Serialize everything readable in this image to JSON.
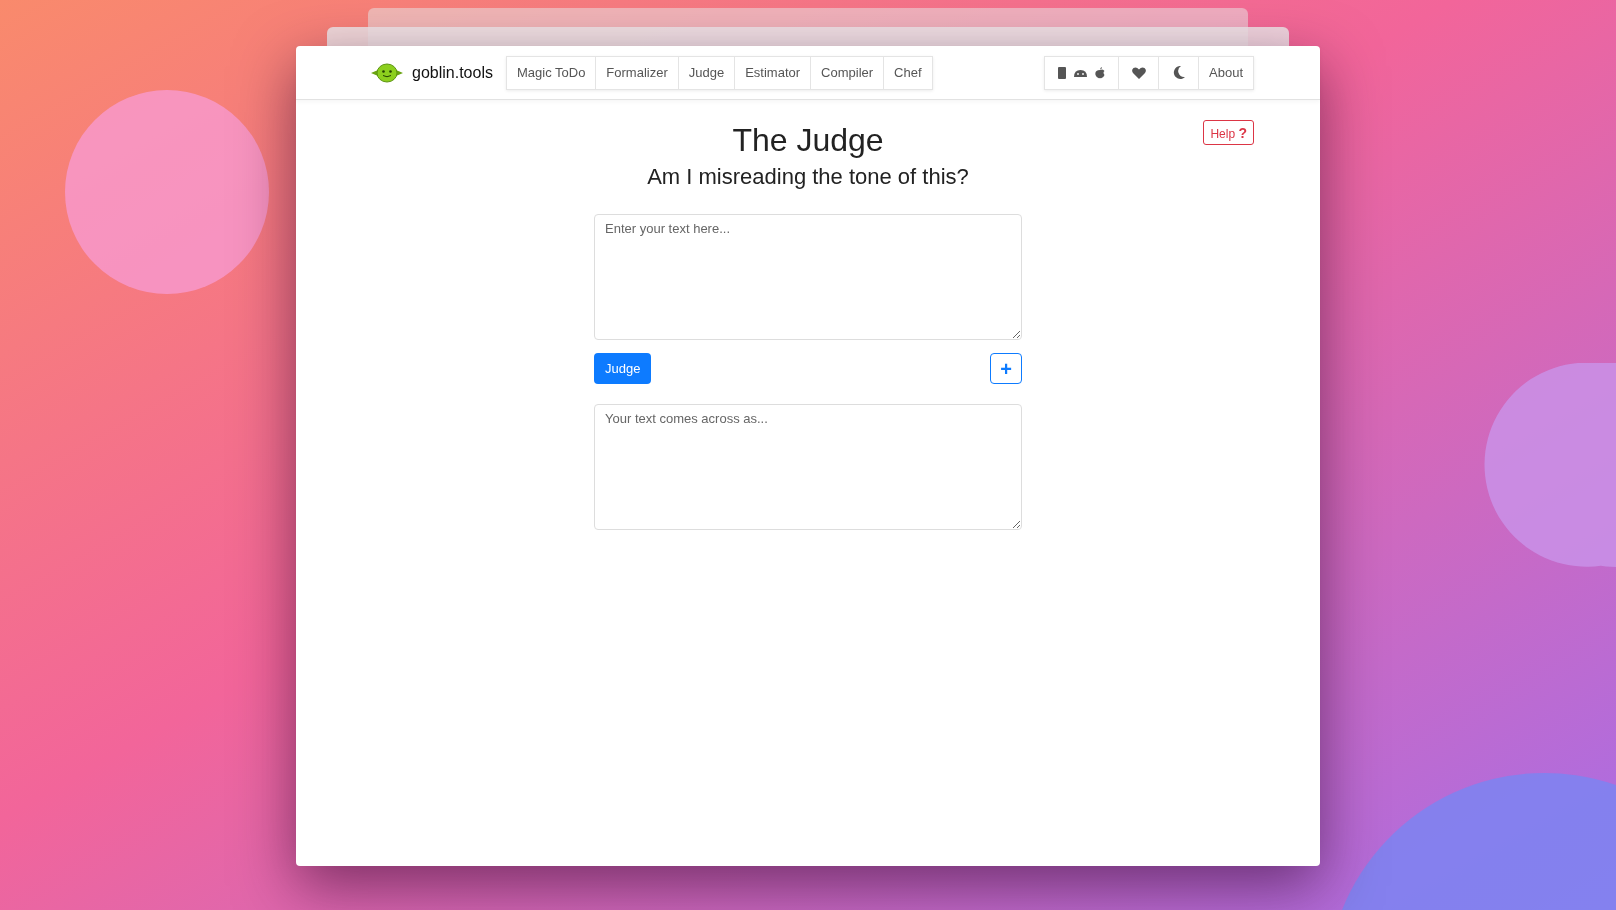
{
  "brand": {
    "name": "goblin.tools"
  },
  "nav": [
    {
      "label": "Magic ToDo"
    },
    {
      "label": "Formalizer"
    },
    {
      "label": "Judge"
    },
    {
      "label": "Estimator"
    },
    {
      "label": "Compiler"
    },
    {
      "label": "Chef"
    }
  ],
  "nav_right": [
    {
      "kind": "apps"
    },
    {
      "kind": "support"
    },
    {
      "kind": "theme"
    },
    {
      "kind": "text",
      "label": "About"
    }
  ],
  "help": {
    "label": "Help",
    "icon": "?"
  },
  "title": "The Judge",
  "subtitle": "Am I misreading the tone of this?",
  "input": {
    "placeholder": "Enter your text here..."
  },
  "judge_button": "Judge",
  "add_button": "+",
  "output": {
    "placeholder": "Your text comes across as..."
  }
}
